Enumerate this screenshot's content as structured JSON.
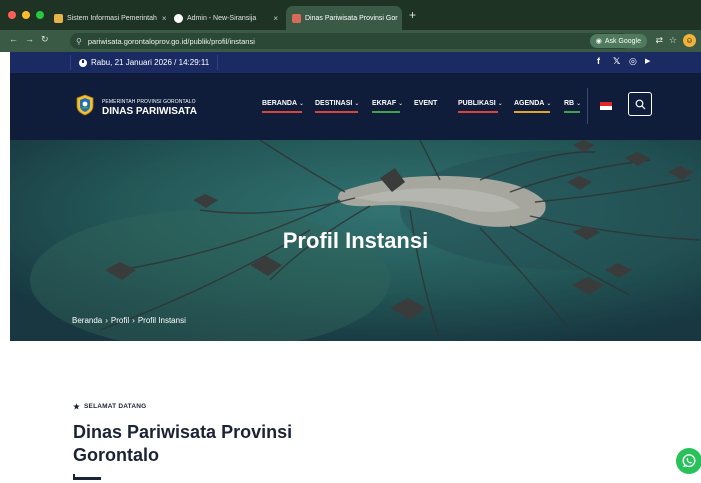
{
  "browser": {
    "tabs": [
      {
        "title": "Sistem Informasi Pemerintah"
      },
      {
        "title": "Admin - New-Siransija"
      },
      {
        "title": "Dinas Pariwisata Provinsi Gor"
      }
    ],
    "close_glyph": "×",
    "newtab_glyph": "+",
    "url": "pariwisata.gorontaloprov.go.id/publik/profil/instansi",
    "ask_google": "Ask Google",
    "colors": {
      "tabstrip": "#1f3325",
      "toolbar": "#3a5a45"
    }
  },
  "topbar": {
    "datetime": "Rabu, 21 Januari 2026 / 14:29:11",
    "social_icons": [
      "facebook-icon",
      "twitter-icon",
      "instagram-icon",
      "youtube-icon"
    ],
    "social_glyphs": [
      "f",
      "𝕏",
      "◎",
      "▶"
    ],
    "color": "#1a2b63"
  },
  "site": {
    "brand_small": "PEMERINTAH PROVINSI GORONTALO",
    "brand_big": "DINAS PARIWISATA",
    "menu": [
      {
        "label": "BERANDA",
        "dropdown": true,
        "accent": "#d9453a"
      },
      {
        "label": "DESTINASI",
        "dropdown": true,
        "accent": "#d9453a"
      },
      {
        "label": "EKRAF",
        "dropdown": true,
        "accent": "#3fa34d"
      },
      {
        "label": "EVENT",
        "dropdown": false,
        "accent": ""
      },
      {
        "label": "PUBLIKASI",
        "dropdown": true,
        "accent": "#d9453a"
      },
      {
        "label": "AGENDA",
        "dropdown": true,
        "accent": "#e0a526"
      },
      {
        "label": "RB",
        "dropdown": true,
        "accent": "#3fa34d"
      }
    ],
    "chevron": "⌄",
    "language_flag": "Indonesia",
    "nav_color": "#0f1d3a"
  },
  "hero": {
    "title": "Profil Instansi",
    "breadcrumb": [
      "Beranda",
      "Profil",
      "Profil Instansi"
    ],
    "separator": "›"
  },
  "content": {
    "eyebrow": "SELAMAT DATANG",
    "heading": "Dinas Pariwisata Provinsi Gorontalo"
  },
  "whatsapp": {
    "icon": "whatsapp-icon",
    "color": "#28c15a"
  }
}
